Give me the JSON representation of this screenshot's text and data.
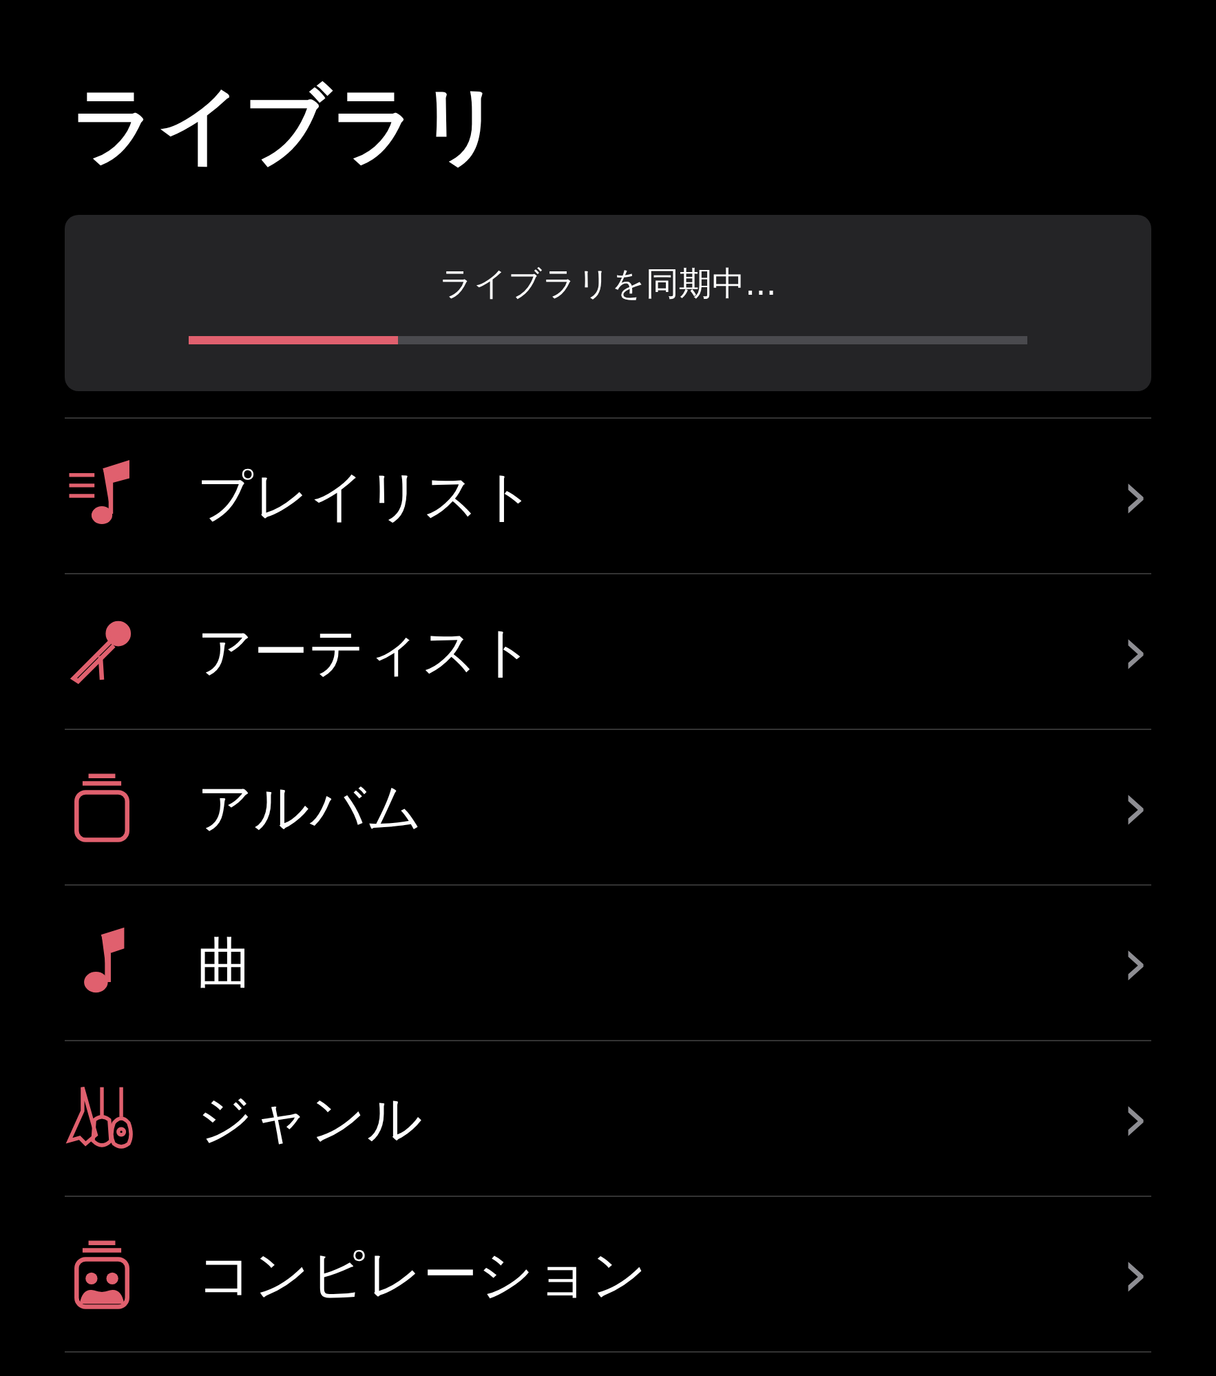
{
  "title": "ライブラリ",
  "sync": {
    "label": "ライブラリを同期中...",
    "level": 0.25
  },
  "items": [
    {
      "kind": "playlists",
      "label": "プレイリスト",
      "chevron": "›"
    },
    {
      "kind": "artists",
      "label": "アーティスト",
      "chevron": "›"
    },
    {
      "kind": "albums",
      "label": "アルバム",
      "chevron": "›"
    },
    {
      "kind": "songs",
      "label": "曲",
      "chevron": "›"
    },
    {
      "kind": "genres",
      "label": "ジャンル",
      "chevron": "›"
    },
    {
      "kind": "compilations",
      "label": "コンピレーション",
      "chevron": "›"
    }
  ]
}
